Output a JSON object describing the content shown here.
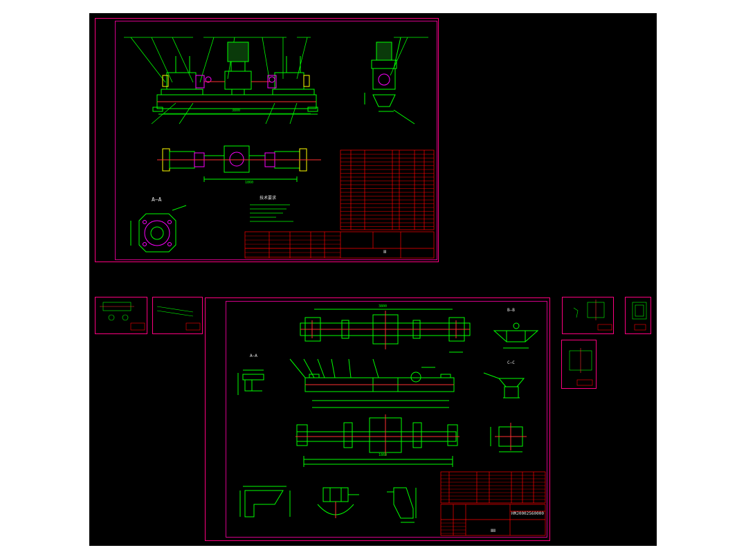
{
  "viewer": {
    "background": "#000000",
    "sheet_border_color": "#ff0080",
    "geometry_color": "#00ff00",
    "table_color": "#ff0000"
  },
  "sheet1": {
    "title_block_label": "Ⅲ",
    "tech_notes_title": "技术要求",
    "section_label": "A—A",
    "dim_overall": "3800",
    "dim_plan": "1860"
  },
  "sheet2": {
    "title_block_label": "ⅢⅡ",
    "drawing_no": "HMJ0002560000",
    "view_b": "B—B",
    "view_c": "C—C",
    "view_a": "A—A",
    "dim_overall": "3800",
    "dim_plan": "1860"
  },
  "thumbnails": [
    "thumb-1",
    "thumb-2",
    "thumb-3",
    "thumb-4",
    "thumb-5"
  ]
}
